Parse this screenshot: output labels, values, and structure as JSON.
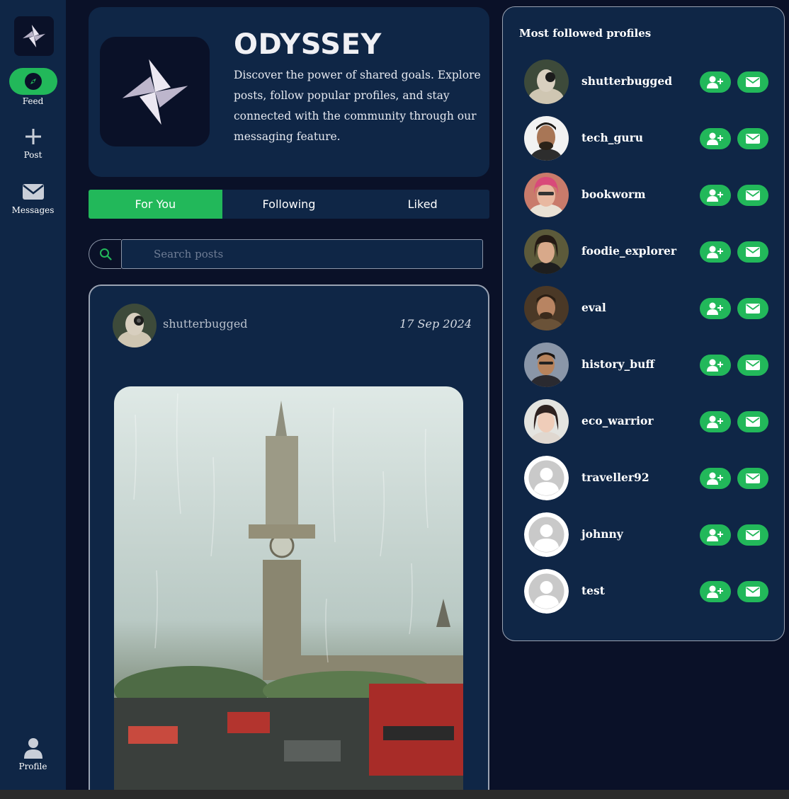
{
  "sidebar": {
    "items": [
      {
        "label": "Feed",
        "icon": "compass-icon"
      },
      {
        "label": "Post",
        "icon": "plus-icon"
      },
      {
        "label": "Messages",
        "icon": "envelope-icon"
      },
      {
        "label": "Profile",
        "icon": "user-icon"
      }
    ]
  },
  "hero": {
    "title": "ODYSSEY",
    "description": "Discover the power of shared goals. Explore posts, follow popular profiles, and stay connected with the community through our messaging feature."
  },
  "tabs": [
    {
      "label": "For You",
      "active": true
    },
    {
      "label": "Following",
      "active": false
    },
    {
      "label": "Liked",
      "active": false
    }
  ],
  "search": {
    "placeholder": "Search posts",
    "value": ""
  },
  "post": {
    "username": "shutterbugged",
    "date": "17 Sep 2024"
  },
  "panel": {
    "title": "Most followed profiles",
    "profiles": [
      {
        "name": "shutterbugged"
      },
      {
        "name": "tech_guru"
      },
      {
        "name": "bookworm"
      },
      {
        "name": "foodie_explorer"
      },
      {
        "name": "eval"
      },
      {
        "name": "history_buff"
      },
      {
        "name": "eco_warrior"
      },
      {
        "name": "traveller92"
      },
      {
        "name": "johnny"
      },
      {
        "name": "test"
      }
    ]
  },
  "colors": {
    "background": "#0a1128",
    "panel": "#0f2646",
    "accent": "#22b85a"
  }
}
